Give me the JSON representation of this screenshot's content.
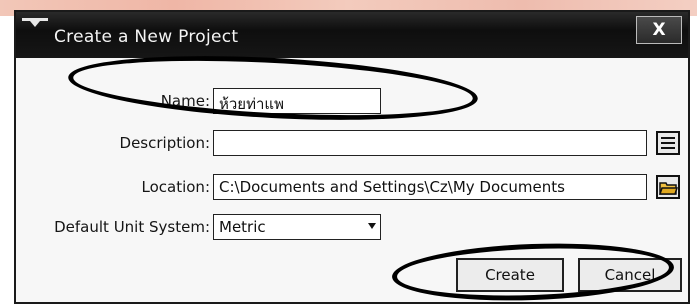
{
  "window": {
    "title": "Create a New Project",
    "close_label": "X"
  },
  "form": {
    "name": {
      "label": "Name:",
      "value": "ห้วยท่าแพ"
    },
    "description": {
      "label": "Description:",
      "value": ""
    },
    "location": {
      "label": "Location:",
      "value": "C:\\Documents and Settings\\Cz\\My Documents"
    },
    "unit_system": {
      "label": "Default Unit System:",
      "value": "Metric"
    }
  },
  "buttons": {
    "create": "Create",
    "cancel": "Cancel"
  },
  "icons": {
    "description_edit": "list-edit-icon",
    "location_browse": "folder-open-icon",
    "close": "close-icon",
    "menu": "window-menu-icon"
  }
}
